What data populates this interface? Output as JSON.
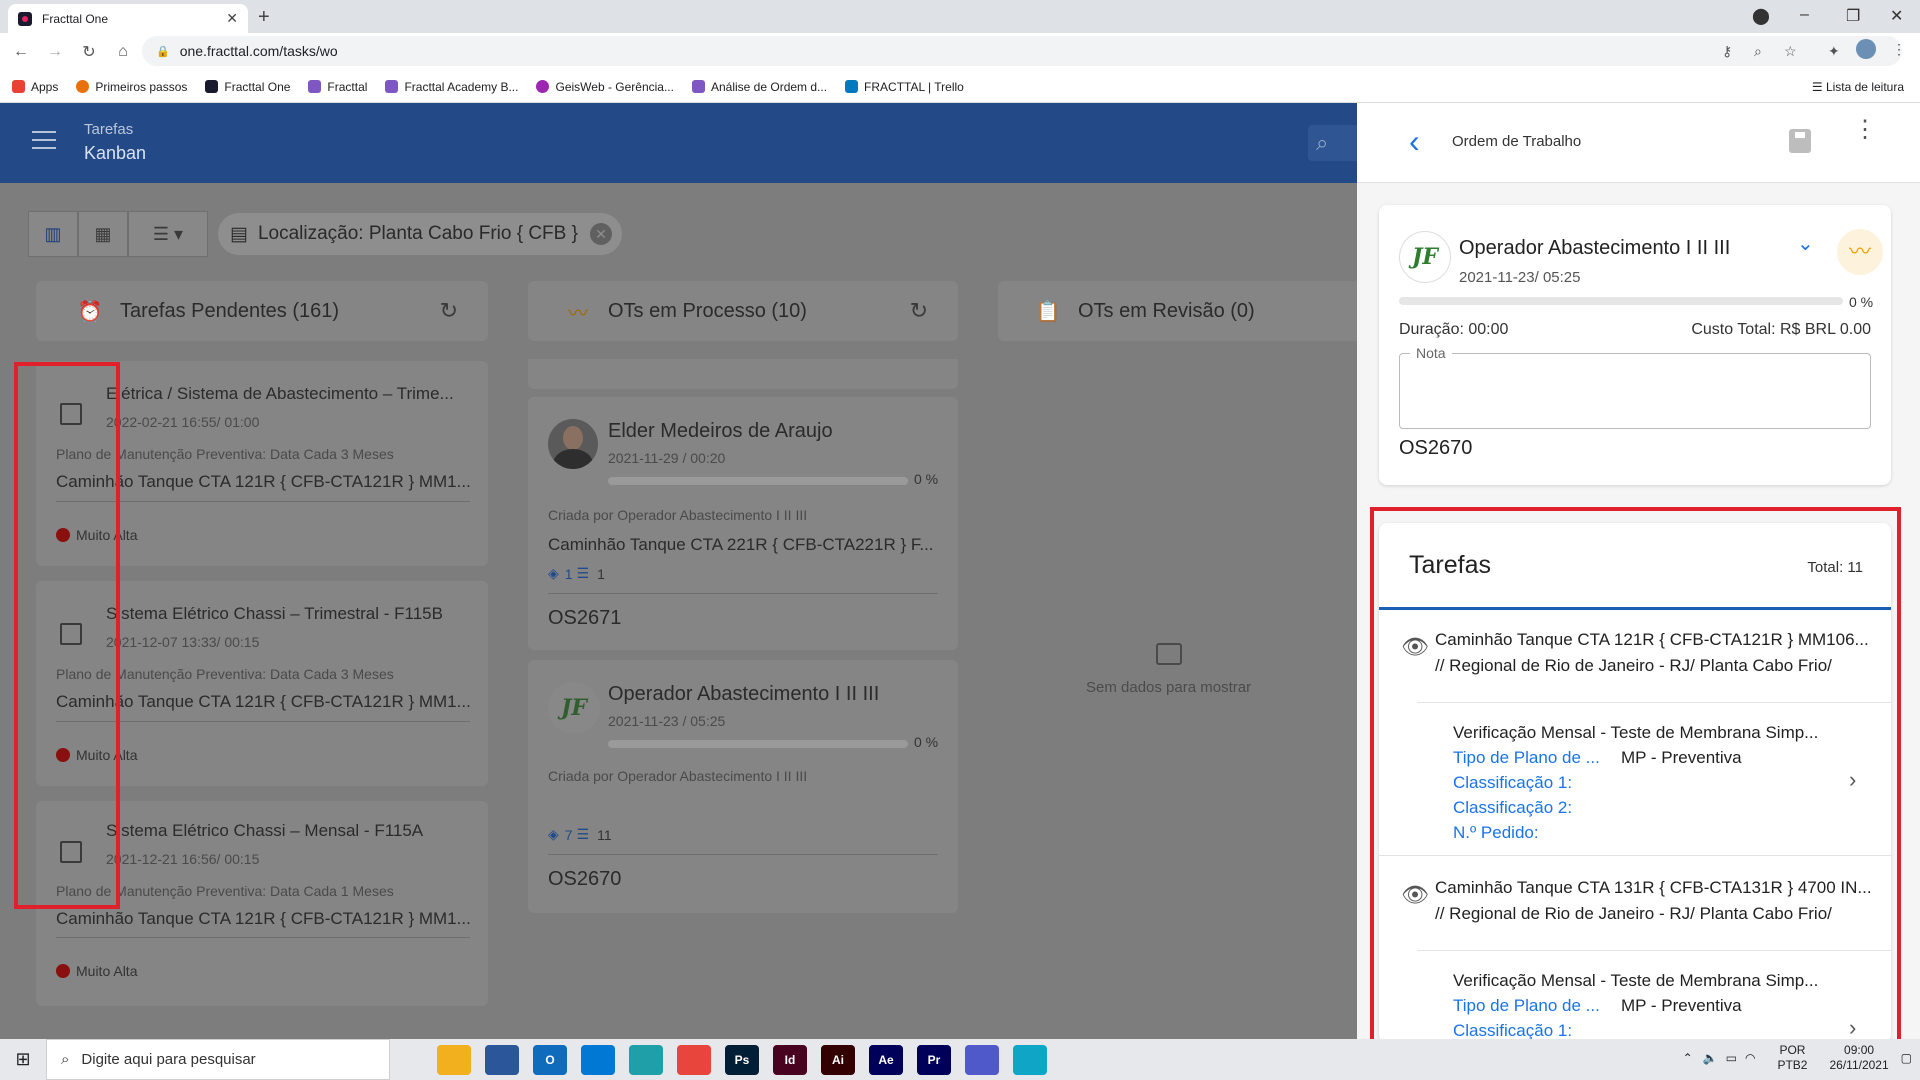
{
  "browser": {
    "tab_title": "Fracttal One",
    "url": "one.fracttal.com/tasks/wo",
    "bookmarks": [
      {
        "label": "Apps",
        "color": "#e94235"
      },
      {
        "label": "Primeiros passos",
        "color": "#e8710a"
      },
      {
        "label": "Fracttal One",
        "color": "#1a1a2e"
      },
      {
        "label": "Fracttal",
        "color": "#7e57c2"
      },
      {
        "label": "Fracttal Academy B...",
        "color": "#7e57c2"
      },
      {
        "label": "GeisWeb - Gerência...",
        "color": "#9c27b0"
      },
      {
        "label": "Análise de Ordem d...",
        "color": "#7e57c2"
      },
      {
        "label": "FRACTTAL | Trello",
        "color": "#0079bf"
      }
    ],
    "reading_list": "Lista de leitura"
  },
  "app": {
    "header_line1": "Tarefas",
    "header_line2": "Kanban",
    "filter_chip": "Localização: Planta Cabo Frio { CFB }",
    "columns": [
      {
        "title": "Tarefas Pendentes (161)",
        "icon": "alarm-icon",
        "icon_color": "#8a1a1a"
      },
      {
        "title": "OTs em Processo (10)",
        "icon": "trend-icon",
        "icon_color": "#a06a00"
      },
      {
        "title": "OTs em Revisão (0)",
        "icon": "clipboard-icon",
        "icon_color": "#223e6e"
      }
    ],
    "pending_cards": [
      {
        "title": "Elétrica / Sistema de Abastecimento – Trime...",
        "date": "2022-02-21 16:55/ 01:00",
        "plan": "Plano de Manutenção Preventiva: Data Cada 3 Meses",
        "asset": "Caminhão Tanque CTA 121R { CFB-CTA121R } MM1...",
        "priority": "Muito Alta"
      },
      {
        "title": "Sistema Elétrico Chassi – Trimestral - F115B",
        "date": "2021-12-07 13:33/ 00:15",
        "plan": "Plano de Manutenção Preventiva: Data Cada 3 Meses",
        "asset": "Caminhão Tanque CTA 121R { CFB-CTA121R } MM1...",
        "priority": "Muito Alta"
      },
      {
        "title": "Sistema Elétrico Chassi – Mensal - F115A",
        "date": "2021-12-21 16:56/ 00:15",
        "plan": "Plano de Manutenção Preventiva: Data Cada 1 Meses",
        "asset": "Caminhão Tanque CTA 121R { CFB-CTA121R } MM1...",
        "priority": "Muito Alta"
      }
    ],
    "process_cards": [
      {
        "name": "Elder Medeiros de Araujo",
        "date": "2021-11-29 / 00:20",
        "progress": "0 %",
        "created_by": "Criada por Operador Abastecimento I II III",
        "asset": "Caminhão Tanque CTA 221R { CFB-CTA221R } F...",
        "meta_a": "1",
        "meta_b": "1",
        "os": "OS2671"
      },
      {
        "name": "Operador Abastecimento I II III",
        "date": "2021-11-23 / 05:25",
        "progress": "0 %",
        "created_by": "Criada por Operador Abastecimento I II III",
        "meta_a": "7",
        "meta_b": "11",
        "os": "OS2670",
        "logo": "JF"
      }
    ],
    "empty_text": "Sem dados para mostrar"
  },
  "panel": {
    "title": "Ordem de Trabalho",
    "wo": {
      "logo": "JF",
      "name": "Operador Abastecimento I II III",
      "date": "2021-11-23/ 05:25",
      "progress": "0 %",
      "progress_value": 0,
      "duration": "Duração: 00:00",
      "cost": "Custo Total: R$ BRL 0.00",
      "note_label": "Nota",
      "os": "OS2670"
    },
    "tasks": {
      "heading": "Tarefas",
      "total": "Total: 11",
      "items": [
        {
          "asset": "Caminhão Tanque CTA 121R { CFB-CTA121R } MM106...",
          "location": "// Regional de Rio de Janeiro - RJ/ Planta Cabo Frio/",
          "task": "Verificação Mensal - Teste de Membrana Simp...",
          "plan_type_label": "Tipo de Plano de ...",
          "plan_type_value": "MP - Preventiva",
          "class1_label": "Classificação 1:",
          "class2_label": "Classificação 2:",
          "order_label": "N.º Pedido:"
        },
        {
          "asset": "Caminhão Tanque CTA 131R { CFB-CTA131R } 4700 IN...",
          "location": "// Regional de Rio de Janeiro - RJ/ Planta Cabo Frio/",
          "task": "Verificação Mensal - Teste de Membrana Simp...",
          "plan_type_label": "Tipo de Plano de ...",
          "plan_type_value": "MP - Preventiva",
          "class1_label": "Classificação 1:"
        }
      ]
    }
  },
  "taskbar": {
    "search_placeholder": "Digite aqui para pesquisar",
    "lang1": "POR",
    "lang2": "PTB2",
    "time": "09:00",
    "date": "26/11/2021",
    "apps": [
      {
        "name": "file-explorer-icon",
        "label": "",
        "color": "#f2b01e"
      },
      {
        "name": "store-icon",
        "label": "",
        "color": "#2b579a"
      },
      {
        "name": "outlook-icon",
        "label": "O",
        "color": "#0f6cbd"
      },
      {
        "name": "mail-icon",
        "label": "",
        "color": "#0078d4"
      },
      {
        "name": "edge-icon",
        "label": "",
        "color": "#1fa0a8"
      },
      {
        "name": "chrome-icon",
        "label": "",
        "color": "#e8453c"
      },
      {
        "name": "photoshop-icon",
        "label": "Ps",
        "color": "#001e36"
      },
      {
        "name": "indesign-icon",
        "label": "Id",
        "color": "#49021f"
      },
      {
        "name": "illustrator-icon",
        "label": "Ai",
        "color": "#330000"
      },
      {
        "name": "aftereffects-icon",
        "label": "Ae",
        "color": "#00005b"
      },
      {
        "name": "premiere-icon",
        "label": "Pr",
        "color": "#00005b"
      },
      {
        "name": "teams-icon",
        "label": "",
        "color": "#5059c9"
      },
      {
        "name": "fracttal-taskbar-icon",
        "label": "",
        "color": "#0ea5c6"
      }
    ]
  }
}
